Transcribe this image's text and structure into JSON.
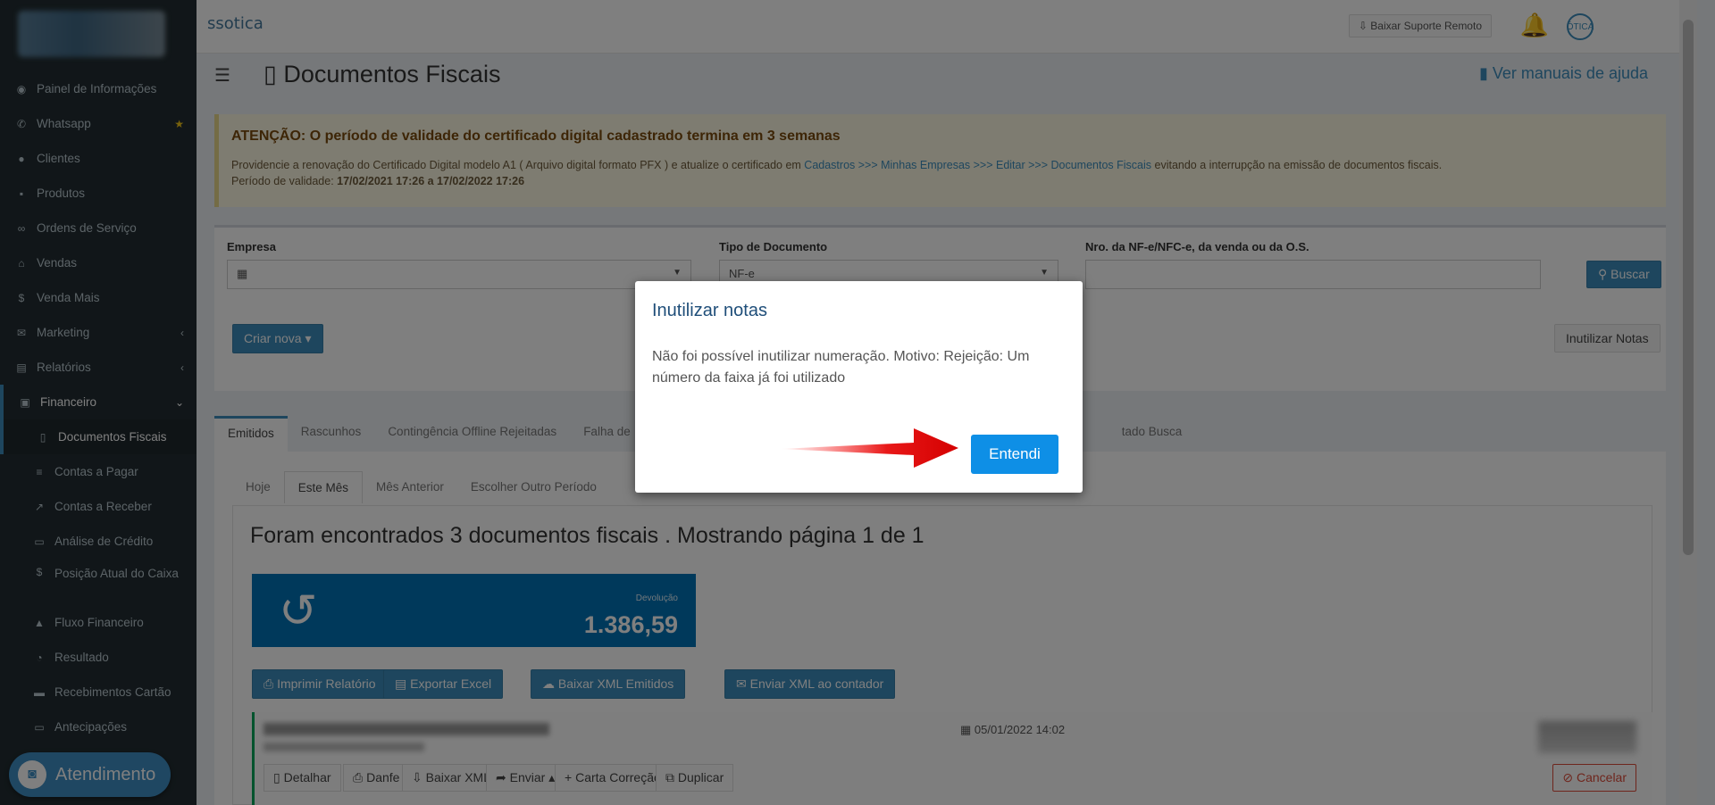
{
  "sidebar": {
    "items": [
      {
        "icon": "dashboard-icon",
        "glyph": "◉",
        "label": "Painel de Informações"
      },
      {
        "icon": "whatsapp-icon",
        "glyph": "✆",
        "label": "Whatsapp"
      },
      {
        "icon": "users-icon",
        "glyph": "👥",
        "label": "Clientes"
      },
      {
        "icon": "cart-icon",
        "glyph": "🛒",
        "label": "Produtos"
      },
      {
        "icon": "glasses-icon",
        "glyph": "∞",
        "label": "Ordens de Serviço"
      },
      {
        "icon": "store-icon",
        "glyph": "⌂",
        "label": "Vendas"
      },
      {
        "icon": "dollar-icon",
        "glyph": "$",
        "label": "Venda Mais"
      },
      {
        "icon": "comments-icon",
        "glyph": "✉",
        "label": "Marketing"
      },
      {
        "icon": "report-icon",
        "glyph": "▤",
        "label": "Relatórios"
      },
      {
        "icon": "money-icon",
        "glyph": "▣",
        "label": "Financeiro"
      },
      {
        "icon": "file-icon",
        "glyph": "▯",
        "label": "Documentos Fiscais"
      },
      {
        "icon": "list-icon",
        "glyph": "≡",
        "label": "Contas a Pagar"
      },
      {
        "icon": "line-chart-icon",
        "glyph": "↗",
        "label": "Contas a Receber"
      },
      {
        "icon": "id-card-icon",
        "glyph": "▭",
        "label": "Análise de Crédito"
      },
      {
        "icon": "dollar-icon",
        "glyph": "$",
        "label": "Posição Atual do Caixa"
      },
      {
        "icon": "area-chart-icon",
        "glyph": "▲",
        "label": "Fluxo Financeiro"
      },
      {
        "icon": "pie-chart-icon",
        "glyph": "◔",
        "label": "Resultado"
      },
      {
        "icon": "credit-card-icon",
        "glyph": "▬",
        "label": "Recebimentos Cartão"
      },
      {
        "icon": "card-icon",
        "glyph": "▭",
        "label": "Antecipações"
      }
    ],
    "atendimento": "Atendimento"
  },
  "topbar": {
    "brand": "ssotica",
    "support_button": "⇩ Baixar Suporte Remoto",
    "bell_glyph": "🔔",
    "avatar_text": "ÓTICA"
  },
  "header": {
    "title": "Documentos Fiscais",
    "help_link": "Ver manuais de ajuda"
  },
  "alert": {
    "title": "ATENÇÃO: O período de validade do certificado digital cadastrado termina em 3 semanas",
    "line1_pre": "Providencie a renovação do Certificado Digital modelo A1 ( Arquivo digital formato PFX ) e atualize o certificado em ",
    "line1_link": "Cadastros >>> Minhas Empresas >>> Editar >>> Documentos Fiscais",
    "line1_post": " evitando a interrupção na emissão de documentos fiscais.",
    "line2_pre": "Período de validade: ",
    "line2_bold": "17/02/2021 17:26 a 17/02/2022 17:26"
  },
  "filters": {
    "empresa_label": "Empresa",
    "tipo_label": "Tipo de Documento",
    "tipo_value": "NF-e",
    "nro_label": "Nro. da NF-e/NFC-e, da venda ou da O.S.",
    "buscar": "Buscar",
    "criar_nova": "Criar nova",
    "inutilizar": "Inutilizar Notas"
  },
  "tabs": [
    "Emitidos",
    "Rascunhos",
    "Contingência Offline Rejeitadas",
    "Falha de",
    "",
    "",
    "",
    "",
    "",
    "tado Busca"
  ],
  "period_tabs": [
    "Hoje",
    "Este Mês",
    "Mês Anterior",
    "Escolher Outro Período"
  ],
  "results": {
    "found_text": "Foram encontrados 3 documentos fiscais . Mostrando página 1 de 1",
    "devolucao_label": "Devolução",
    "devolucao_value": "1.386,59"
  },
  "actions": {
    "imprimir": "Imprimir Relatório",
    "exportar": "Exportar Excel",
    "baixar_xml": "Baixar XML Emitidos",
    "enviar_xml": "Enviar XML ao contador"
  },
  "document": {
    "date": "05/01/2022 14:02",
    "detalhar": "Detalhar",
    "danfe": "Danfe",
    "baixar_xml": "Baixar XML",
    "enviar": "Enviar",
    "carta": "Carta Correção",
    "duplicar": "Duplicar",
    "cancelar": "Cancelar"
  },
  "modal": {
    "title": "Inutilizar notas",
    "message": "Não foi possível inutilizar numeração. Motivo: Rejeição: Um número da faixa já foi utilizado",
    "button": "Entendi"
  }
}
